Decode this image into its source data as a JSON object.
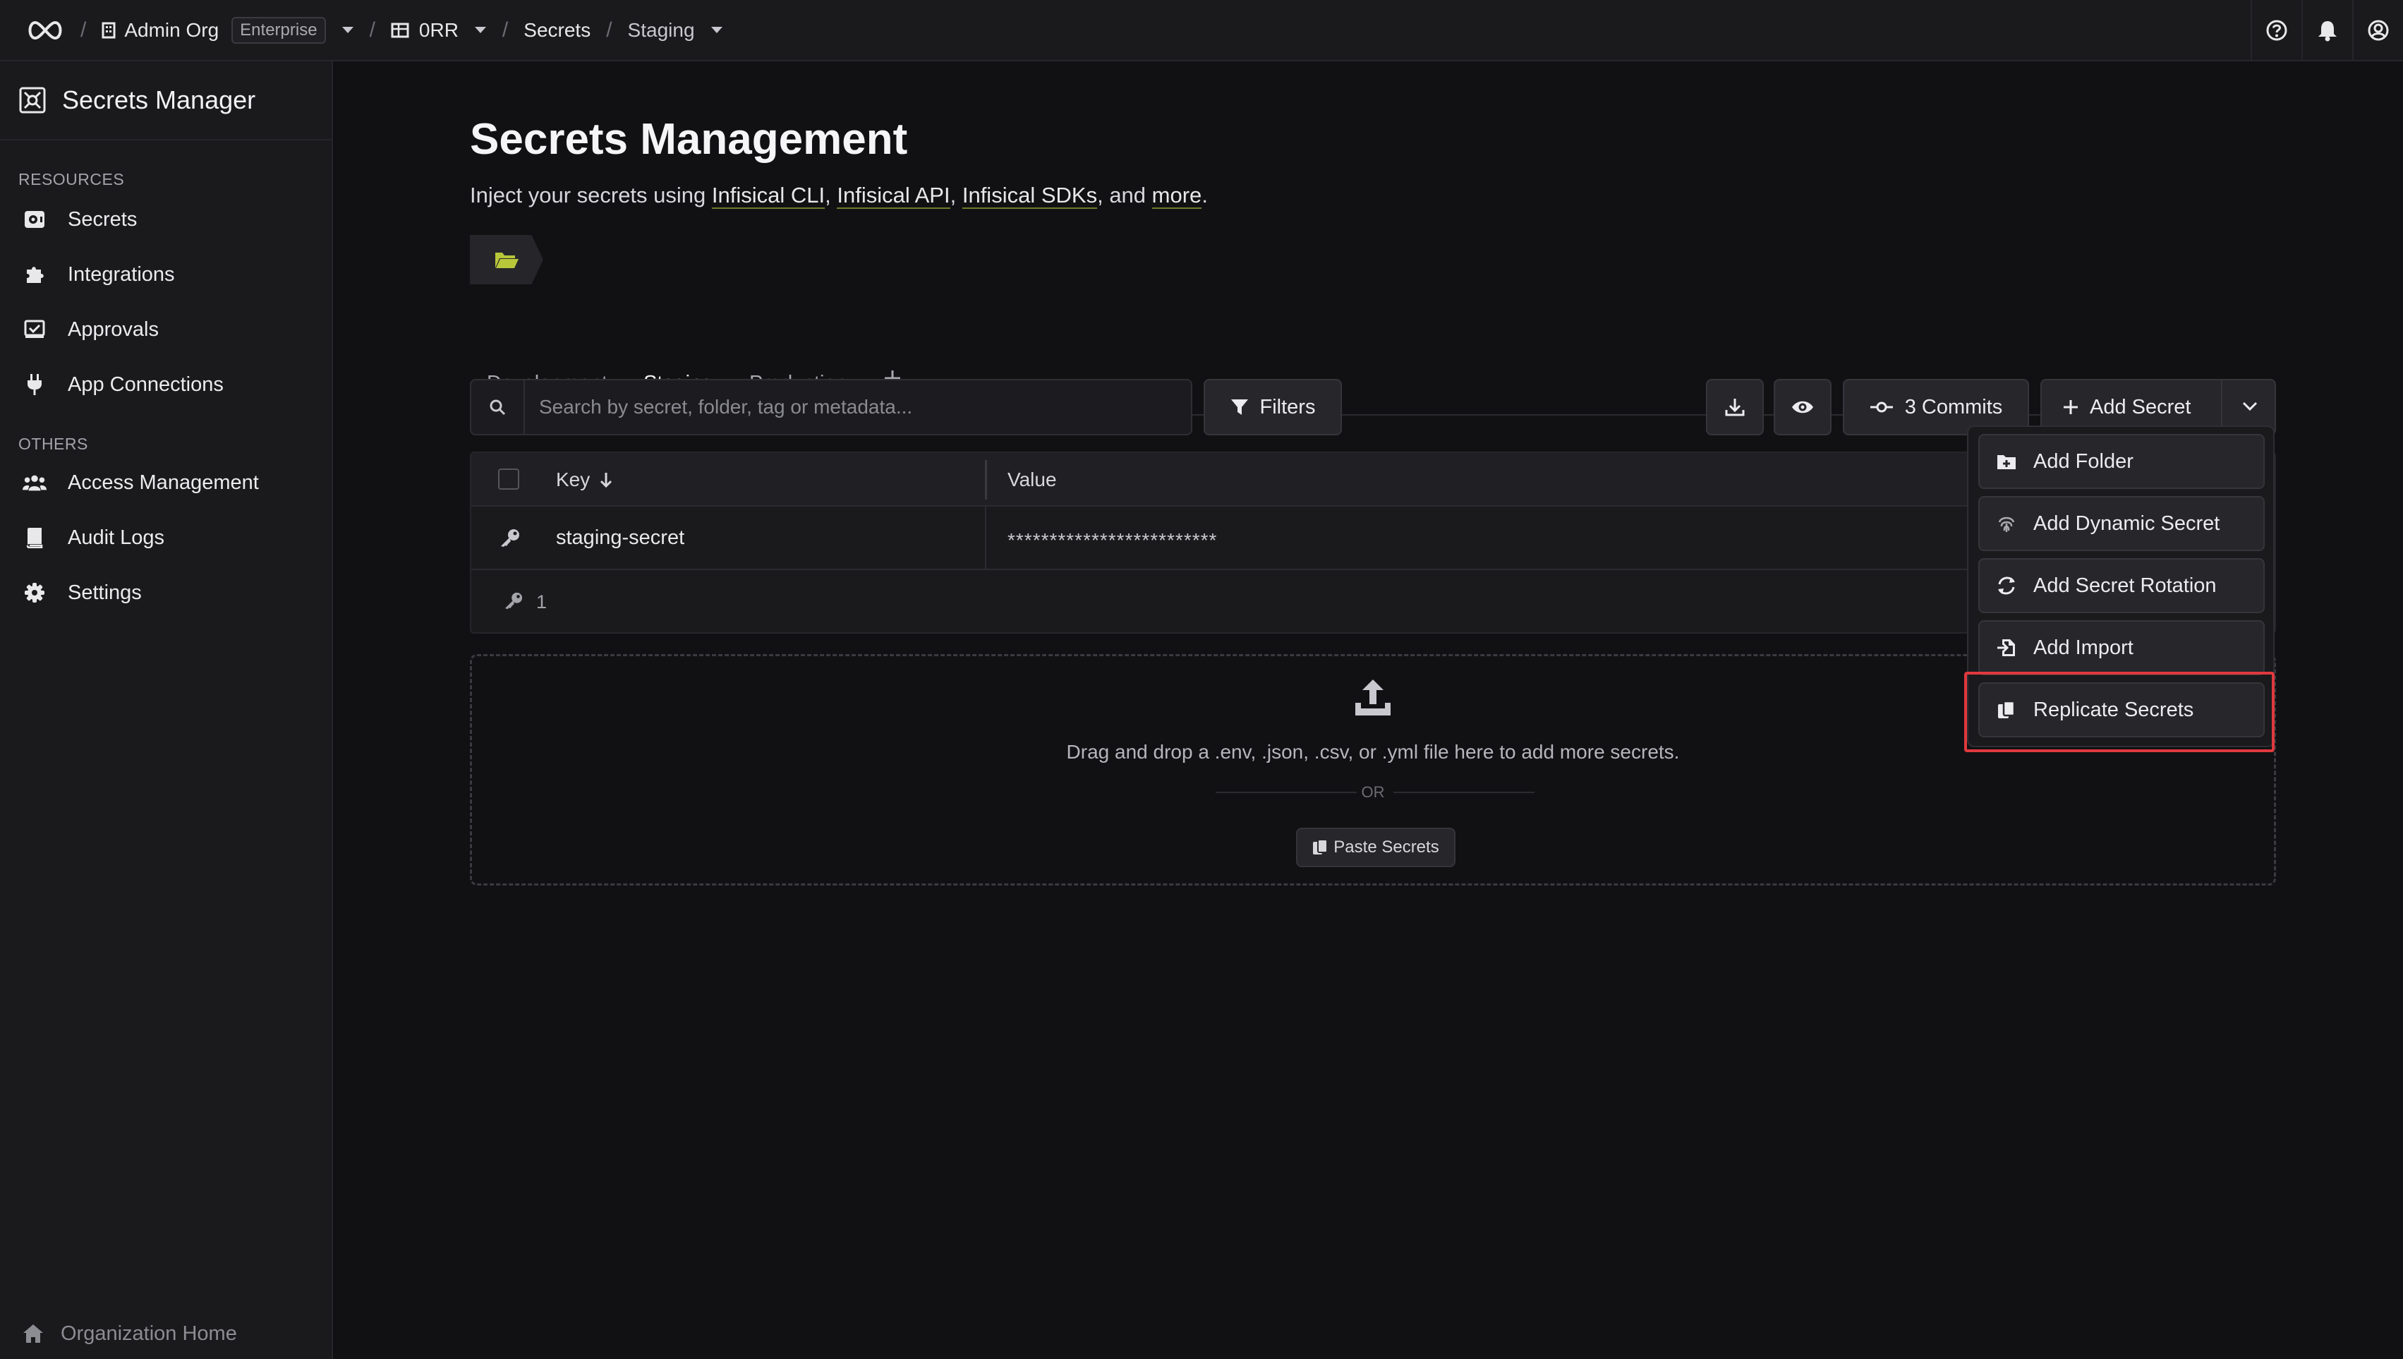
{
  "topbar": {
    "org_name": "Admin Org",
    "org_plan": "Enterprise",
    "project": "0RR",
    "section": "Secrets",
    "environment": "Staging"
  },
  "sidebar": {
    "title": "Secrets Manager",
    "resources_heading": "RESOURCES",
    "resources": [
      {
        "label": "Secrets",
        "icon": "secrets-icon"
      },
      {
        "label": "Integrations",
        "icon": "puzzle-icon"
      },
      {
        "label": "Approvals",
        "icon": "approvals-icon"
      },
      {
        "label": "App Connections",
        "icon": "plug-icon"
      }
    ],
    "others_heading": "OTHERS",
    "others": [
      {
        "label": "Access Management",
        "icon": "users-icon"
      },
      {
        "label": "Audit Logs",
        "icon": "book-icon"
      },
      {
        "label": "Settings",
        "icon": "gear-icon"
      }
    ],
    "footer": "Organization Home"
  },
  "main": {
    "title": "Secrets Management",
    "subtitle_prefix": "Inject your secrets using",
    "links": [
      "Infisical CLI",
      "Infisical API",
      "Infisical SDKs",
      "more"
    ],
    "subtitle_and": "and",
    "tabs": [
      "Development",
      "Staging",
      "Production"
    ],
    "active_tab": "Staging",
    "search_placeholder": "Search by secret, folder, tag or metadata...",
    "filters_label": "Filters",
    "commits_label": "3 Commits",
    "add_secret_label": "Add Secret",
    "table": {
      "key_header": "Key",
      "value_header": "Value",
      "rows": [
        {
          "key": "staging-secret",
          "value": "*************************"
        }
      ],
      "count": "1"
    },
    "dropzone": {
      "text": "Drag and drop a .env, .json, .csv, or .yml file here to add more secrets.",
      "or": "OR",
      "paste_label": "Paste Secrets"
    }
  },
  "dropdown": {
    "items": [
      "Add Folder",
      "Add Dynamic Secret",
      "Add Secret Rotation",
      "Add Import",
      "Replicate Secrets"
    ],
    "highlighted": "Replicate Secrets"
  },
  "colors": {
    "background": "#111114",
    "panel": "#1a1a1d",
    "accent": "#b8c63a",
    "highlight": "#e0393e"
  }
}
